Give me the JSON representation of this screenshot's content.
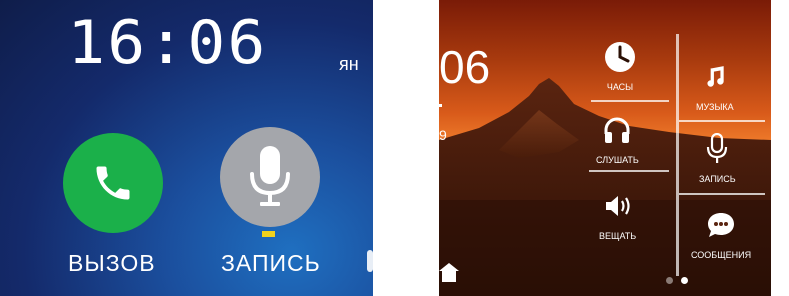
{
  "left_screen": {
    "clock": "16:06",
    "date_partial": "ян",
    "call_button_label": "ВЫЗОВ",
    "record_button_label": "ЗАПИСЬ",
    "colors": {
      "call": "#1bb04a",
      "record": "#a4a6ab",
      "focus": "#f1d21d"
    },
    "icons": {
      "call": "phone-icon",
      "record": "microphone-icon"
    }
  },
  "right_screen": {
    "clock_partial": "06",
    "text_partial": "9",
    "menu": [
      {
        "label": "ЧАСЫ",
        "icon": "clock-icon"
      },
      {
        "label": "МУЗЫКА",
        "icon": "music-note-icon"
      },
      {
        "label": "СЛУШАТЬ",
        "icon": "headphones-icon"
      },
      {
        "label": "ЗАПИСЬ",
        "icon": "microphone-icon"
      },
      {
        "label": "ВЕЩАТЬ",
        "icon": "speaker-icon"
      },
      {
        "label": "СООБЩЕНИЯ",
        "icon": "chat-bubble-icon"
      }
    ],
    "page_indicator": {
      "total": 2,
      "current": 2
    }
  }
}
